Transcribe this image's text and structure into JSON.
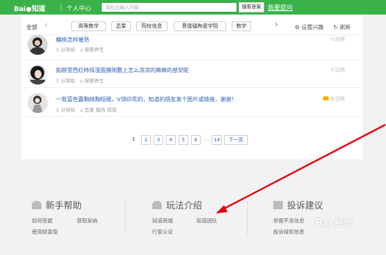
{
  "header": {
    "logo_text": "Bai",
    "logo_suffix": "知道",
    "user_center": "个人中心",
    "search_placeholder": "请在此输入问题",
    "search_button": "搜索答案",
    "ask_button": "我要提问"
  },
  "category_bar": {
    "all_label": "全部",
    "tags": [
      "高等数学",
      "恋爱",
      "院校信息",
      "景德镇陶瓷学院",
      "数学"
    ],
    "settings_label": "设置兴趣",
    "refresh_label": "刷新"
  },
  "questions": [
    {
      "title": "鳊桃怎样催熟",
      "time": "1 分钟前",
      "tags": [
        "保健养生"
      ],
      "answers": "0",
      "answers_label": "回答"
    },
    {
      "title": "韵颜堂西红柿保湿面膜刚敷上怎么凉凉的麻麻的感觉呢",
      "time": "1 分钟前",
      "tags": [
        "保健养生"
      ],
      "answers": "0",
      "answers_label": "回答"
    },
    {
      "title": "一款蓝色露胸抹胸短裙，V领印花的，知道的朋友发个图片或链接，谢谢！",
      "time": "1 分钟前",
      "tags": [
        "恋爱",
        "服饰",
        "情感"
      ],
      "answers": "5",
      "answers_label": "回答"
    }
  ],
  "pagination": {
    "pages": [
      "1",
      "2",
      "3",
      "4",
      "5",
      "6"
    ],
    "ellipsis": "...",
    "last_page": "14",
    "next": "下一页"
  },
  "footer": {
    "sections": [
      {
        "title": "新手帮助",
        "links": [
          "如何答题",
          "获取采纳",
          "使用财富值"
        ]
      },
      {
        "title": "玩法介绍",
        "links": [
          "知道商城",
          "知道团队",
          "行家认证"
        ]
      },
      {
        "title": "投诉建议",
        "links": [
          "举报不良信息",
          "投诉侵权信息"
        ]
      }
    ]
  },
  "watermark": "Bai 经验",
  "colors": {
    "brand_green": "#3bb14a",
    "link_blue": "#2a5db0",
    "annotation_red": "#e60012"
  }
}
